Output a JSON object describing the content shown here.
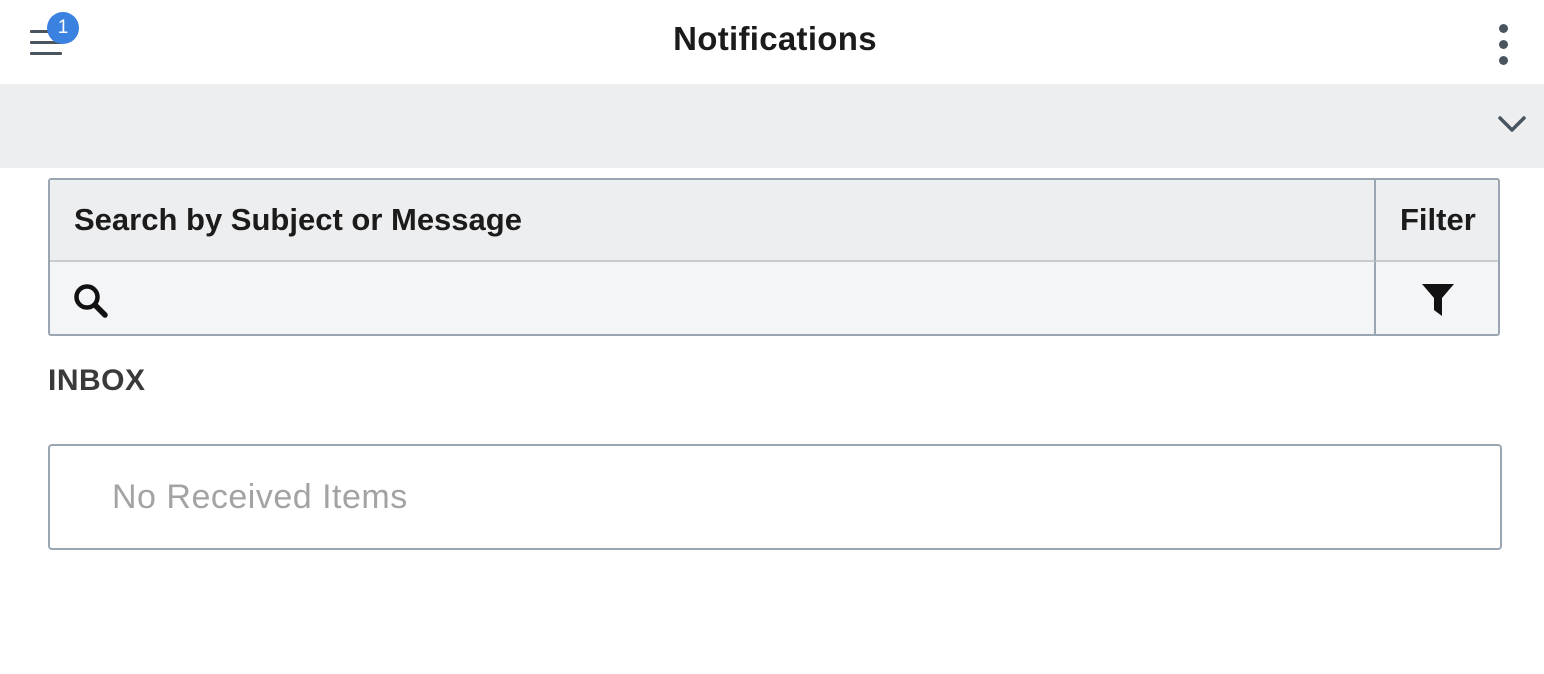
{
  "header": {
    "title": "Notifications",
    "menu_badge_count": "1",
    "menu_icon": "hamburger-icon",
    "more_icon": "kebab-icon"
  },
  "collapse_bar": {
    "icon": "chevron-down-icon"
  },
  "search_panel": {
    "search_label": "Search by Subject or Message",
    "search_value": "",
    "search_icon": "search-icon",
    "filter_label": "Filter",
    "filter_icon": "filter-icon"
  },
  "inbox": {
    "title": "INBOX",
    "empty_message": "No Received Items"
  },
  "colors": {
    "badge": "#3b82e0",
    "panel_bg": "#edeef0",
    "border": "#9aa6b2",
    "empty_text": "#a3a3a3"
  }
}
